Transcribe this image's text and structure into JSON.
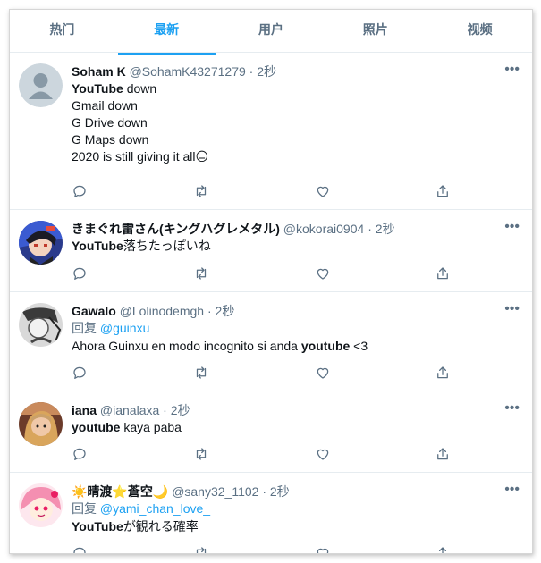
{
  "tabs": [
    "热门",
    "最新",
    "用户",
    "照片",
    "视频"
  ],
  "active_tab_index": 1,
  "accent_color": "#1da1f2",
  "more_glyph": "•••",
  "tweets": [
    {
      "name": "Soham K",
      "handle": "@SohamK43271279",
      "sep": "·",
      "time": "2秒",
      "avatar": "default-avatar",
      "bold": "YouTube",
      "line1_rest": " down",
      "lines": [
        "Gmail down",
        "G Drive down",
        "G Maps down",
        "2020 is still giving it all😑"
      ]
    },
    {
      "name": "きまぐれ雷さん(キングハグレメタル)",
      "handle": "@kokorai0904",
      "sep": "·",
      "time": "2秒",
      "avatar": "anime-avatar",
      "bold": "YouTube",
      "line1_rest": "落ちたっぽいね"
    },
    {
      "name": "Gawalo",
      "handle": "@Lolinodemgh",
      "sep": "·",
      "time": "2秒",
      "avatar": "sketch-avatar",
      "reply_prefix": "回复 ",
      "reply_to": "@guinxu",
      "text_before": "Ahora Guinxu en modo incognito si anda ",
      "bold": "youtube",
      "text_after": " <3"
    },
    {
      "name": "iana",
      "handle": "@ianalaxa",
      "sep": "·",
      "time": "2秒",
      "avatar": "photo-avatar",
      "bold": "youtube",
      "line1_rest": " kaya paba"
    },
    {
      "name": "☀️晴渡⭐蒼空🌙",
      "handle": "@sany32_1102",
      "sep": "·",
      "time": "2秒",
      "avatar": "pink-anime-avatar",
      "reply_prefix": "回复 ",
      "reply_to": "@yami_chan_love_",
      "bold": "YouTube",
      "line1_rest": "が観れる確率"
    }
  ]
}
